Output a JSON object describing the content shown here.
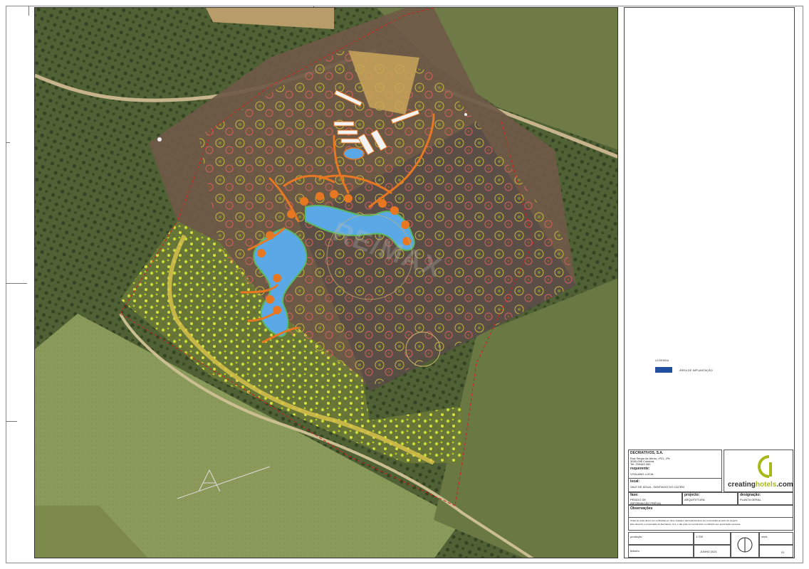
{
  "legend": {
    "title": "LEGENDA",
    "area_label": "ÁREA DE IMPLANTAÇÃO ",
    "area_color": "#1f4f9f"
  },
  "title_block": {
    "company": "DECRIATIVOS, S.A.",
    "address_lines": [
      "Rua Sérgio de Abreu, nº21, 2ºe",
      "3030-096 Coimbra",
      "Tel: 239483 352"
    ],
    "client_label": "requerente:",
    "client_value": "VITALANG LÚCIA",
    "location_label": "local:",
    "location_value": "VALE DE ÁGUA - SANTIAGO DO CACÉM",
    "phase_label": "fase:",
    "phase_value_1": "PEDIDO DE",
    "phase_value_2": "INFORMAÇÃO PRÉVIA",
    "project_label": "projecto:",
    "project_value": "ARQUITETURA",
    "designation_label": "designação:",
    "designation_value": "PLANTA GERAL",
    "observations_label": "Observações",
    "notes_1": "Todas as cotas devem ser verificadas em obra. Qualquer discrepância deve ser comunicada ao autor do projecto.",
    "notes_2": "Este desenho é propriedade da Decriativos, S.A. e não pode ser reproduzido ou utilizado sem autorização expressa.",
    "scale_label": "1:700",
    "date_value": "JUNHO 2021",
    "sheet_number": "01",
    "prod_label": "produção",
    "folder_label": "ficheiro",
    "rev_label": "revis"
  },
  "logo": {
    "text_main": "creating",
    "text_accent": "hotels",
    "text_tail": ".com",
    "accent_color": "#a7b819"
  },
  "map": {
    "watermark": "RE/MAX",
    "water_color": "#5aa9e6",
    "path_color": "#e87722",
    "boundary_color": "#d22020"
  }
}
